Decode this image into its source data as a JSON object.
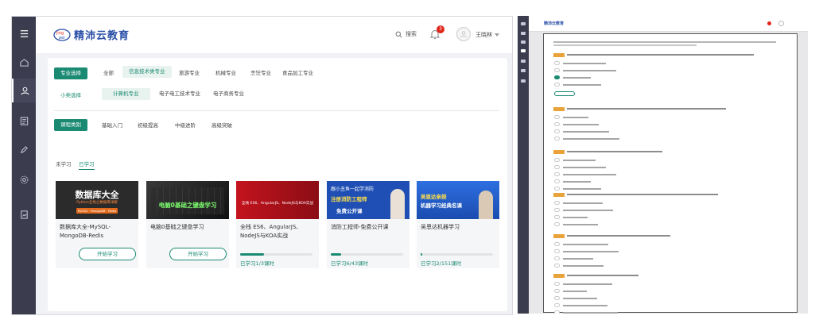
{
  "brand": {
    "name": "精沛云教育",
    "primary_color": "#1a8a72",
    "logo_color": "#2a4fa8"
  },
  "sidebar": {
    "items": [
      {
        "icon": "menu-icon"
      },
      {
        "icon": "home-icon"
      },
      {
        "icon": "user-icon"
      },
      {
        "icon": "document-icon"
      },
      {
        "icon": "pen-icon"
      },
      {
        "icon": "gear-icon"
      },
      {
        "icon": "report-icon"
      }
    ]
  },
  "topbar": {
    "search_label": "搜索",
    "notification_count": "3",
    "username": "王晓林"
  },
  "filters": {
    "major": {
      "label": "专业选择",
      "options": [
        "全部",
        "信息技术类专业",
        "旅游专业",
        "机械专业",
        "烹饪专业",
        "食品加工专业"
      ],
      "selected": "信息技术类专业"
    },
    "minor": {
      "label": "小类选择",
      "options": [
        "计算机专业",
        "电子电工技术专业",
        "电子商务专业"
      ],
      "selected": "计算机专业"
    },
    "level": {
      "label": "课程类别",
      "options": [
        "基础入门",
        "初级提高",
        "中级进阶",
        "高级突破"
      ]
    }
  },
  "study_tabs": {
    "items": [
      "未学习",
      "已学习"
    ],
    "active": "已学习"
  },
  "courses": [
    {
      "title": "数据库大全-MySQL-MongoDB-Redis",
      "cover_title": "数据库大全",
      "cover_subtitle": "Python全栈之数据库详解",
      "cover_tags": "MySQL · MongoDB · Redis",
      "cover_color": "#2b2b2b",
      "button": "开始学习",
      "status": "start"
    },
    {
      "title": "电脑0基础之键盘学习",
      "cover_title": "电脑0基础之键盘学习",
      "cover_color": "#1b1b1b",
      "button": "开始学习",
      "status": "start"
    },
    {
      "title": "全栈 ES6、AngularJS、NodeJS与KOA实战",
      "cover_title": "全栈 ES6、AngularJS、NodeJS与KOA实战",
      "cover_color": "#b3121b",
      "progress": 0.33,
      "progress_text": "已学习1/3课时",
      "status": "progress"
    },
    {
      "title": "消防工程师-免费公开课",
      "cover_title": "跟小丑鱼一起学消防",
      "cover_subtitle": "注册消防工程师",
      "cover_tag": "免费公开课",
      "cover_color": "#1f4fb4",
      "progress": 0.14,
      "progress_text": "已学习6/43课时",
      "status": "progress"
    },
    {
      "title": "吴恩达机器学习",
      "cover_title": "吴恩达亲授",
      "cover_subtitle": "机器学习经典名课",
      "cover_color": "#2d6fe0",
      "progress": 0.01,
      "progress_text": "已学习2/151课时",
      "status": "progress"
    }
  ],
  "right_panel": {
    "brand": "精沛云教育"
  }
}
